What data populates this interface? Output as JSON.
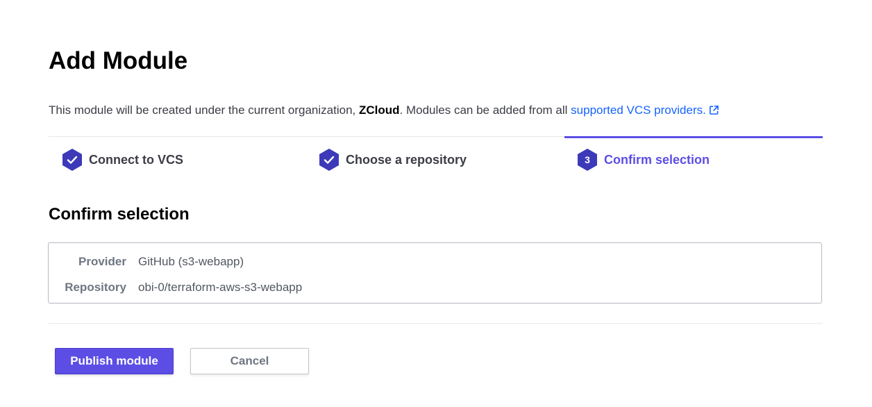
{
  "header": {
    "title": "Add Module"
  },
  "intro": {
    "prefix": "This module will be created under the current organization, ",
    "organization": "ZCloud",
    "middle": ". Modules can be added from all ",
    "link_text": "supported VCS providers.",
    "link_icon": "external-link-icon"
  },
  "steps": [
    {
      "label": "Connect to VCS",
      "state": "complete",
      "icon": "check-icon"
    },
    {
      "label": "Choose a repository",
      "state": "complete",
      "icon": "check-icon"
    },
    {
      "label": "Confirm selection",
      "state": "active",
      "number": "3"
    }
  ],
  "section": {
    "title": "Confirm selection"
  },
  "summary": {
    "rows": [
      {
        "key": "Provider",
        "value": "GitHub (s3-webapp)"
      },
      {
        "key": "Repository",
        "value": "obi-0/terraform-aws-s3-webapp"
      }
    ]
  },
  "actions": {
    "publish_label": "Publish module",
    "cancel_label": "Cancel"
  },
  "colors": {
    "accent": "#5c4ee5",
    "step_hex": "#3c3ab8",
    "link": "#1563ff"
  }
}
